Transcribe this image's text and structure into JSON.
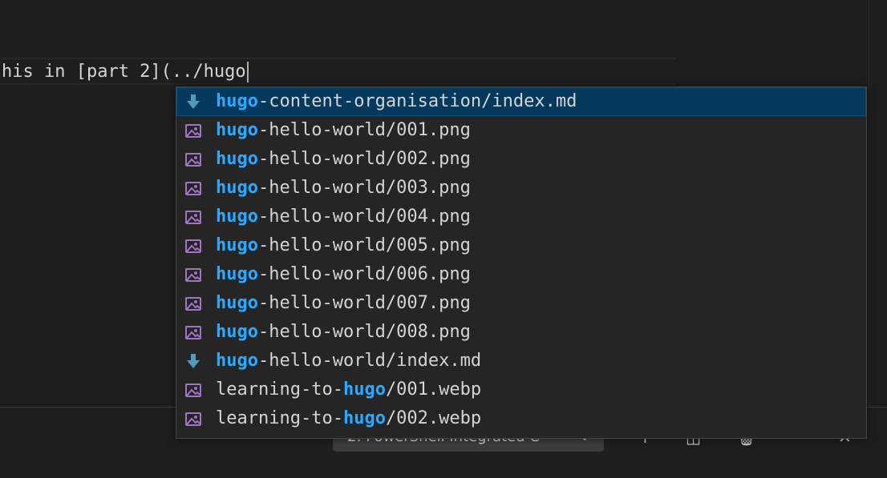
{
  "editor": {
    "line_text": "his in [part 2](../hugo"
  },
  "suggestions": [
    {
      "icon": "markdown-file-icon",
      "pre": "",
      "match": "hugo",
      "post": "-content-organisation/index.md",
      "selected": true
    },
    {
      "icon": "image-file-icon",
      "pre": "",
      "match": "hugo",
      "post": "-hello-world/001.png"
    },
    {
      "icon": "image-file-icon",
      "pre": "",
      "match": "hugo",
      "post": "-hello-world/002.png"
    },
    {
      "icon": "image-file-icon",
      "pre": "",
      "match": "hugo",
      "post": "-hello-world/003.png"
    },
    {
      "icon": "image-file-icon",
      "pre": "",
      "match": "hugo",
      "post": "-hello-world/004.png"
    },
    {
      "icon": "image-file-icon",
      "pre": "",
      "match": "hugo",
      "post": "-hello-world/005.png"
    },
    {
      "icon": "image-file-icon",
      "pre": "",
      "match": "hugo",
      "post": "-hello-world/006.png"
    },
    {
      "icon": "image-file-icon",
      "pre": "",
      "match": "hugo",
      "post": "-hello-world/007.png"
    },
    {
      "icon": "image-file-icon",
      "pre": "",
      "match": "hugo",
      "post": "-hello-world/008.png"
    },
    {
      "icon": "markdown-file-icon",
      "pre": "",
      "match": "hugo",
      "post": "-hello-world/index.md"
    },
    {
      "icon": "image-file-icon",
      "pre": "learning-to-",
      "match": "hugo",
      "post": "/001.webp"
    },
    {
      "icon": "image-file-icon",
      "pre": "learning-to-",
      "match": "hugo",
      "post": "/002.webp"
    }
  ],
  "terminal": {
    "selected_shell": "2: PowerShell Integrated C"
  },
  "colors": {
    "highlight": "#2aaaff",
    "selected_row": "#04395e",
    "markdown_icon": "#519aba",
    "image_icon": "#a074c4"
  }
}
